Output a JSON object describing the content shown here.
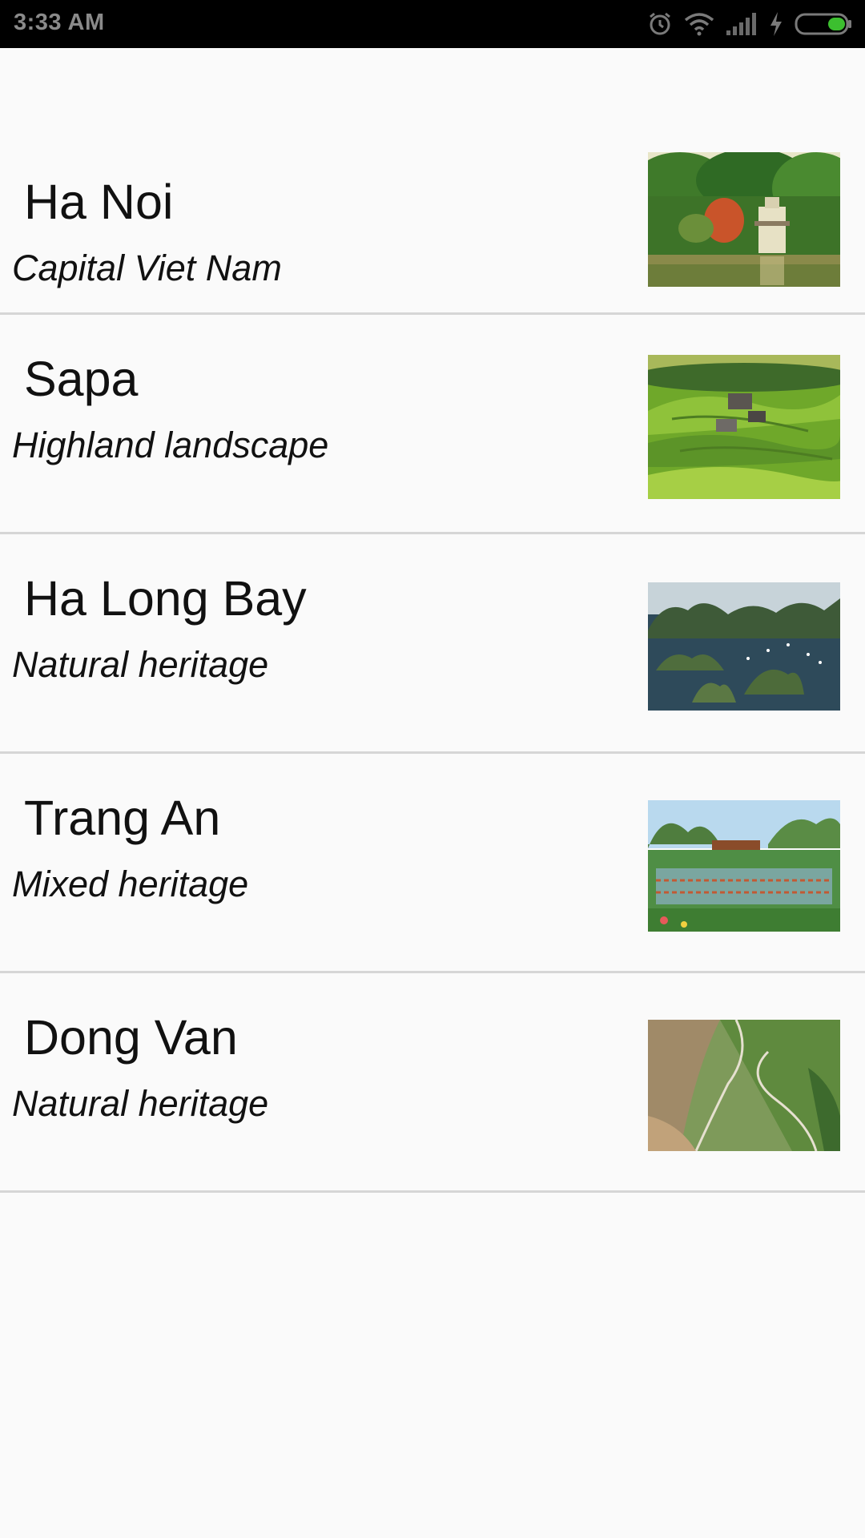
{
  "status_bar": {
    "time": "3:33 AM",
    "icons": [
      "alarm-icon",
      "wifi-icon",
      "signal-icon",
      "charging-icon",
      "battery-icon"
    ],
    "battery_color": "#3cbf2f"
  },
  "places": [
    {
      "title": "Ha Noi",
      "subtitle": "Capital Viet Nam",
      "image": "hanoi-turtle-tower-photo"
    },
    {
      "title": "Sapa",
      "subtitle": "Highland landscape",
      "image": "sapa-rice-terraces-photo"
    },
    {
      "title": "Ha Long Bay",
      "subtitle": "Natural heritage",
      "image": "halong-bay-photo"
    },
    {
      "title": "Trang An",
      "subtitle": "Mixed heritage",
      "image": "trang-an-photo"
    },
    {
      "title": "Dong Van",
      "subtitle": "Natural heritage",
      "image": "dong-van-pass-photo"
    }
  ]
}
